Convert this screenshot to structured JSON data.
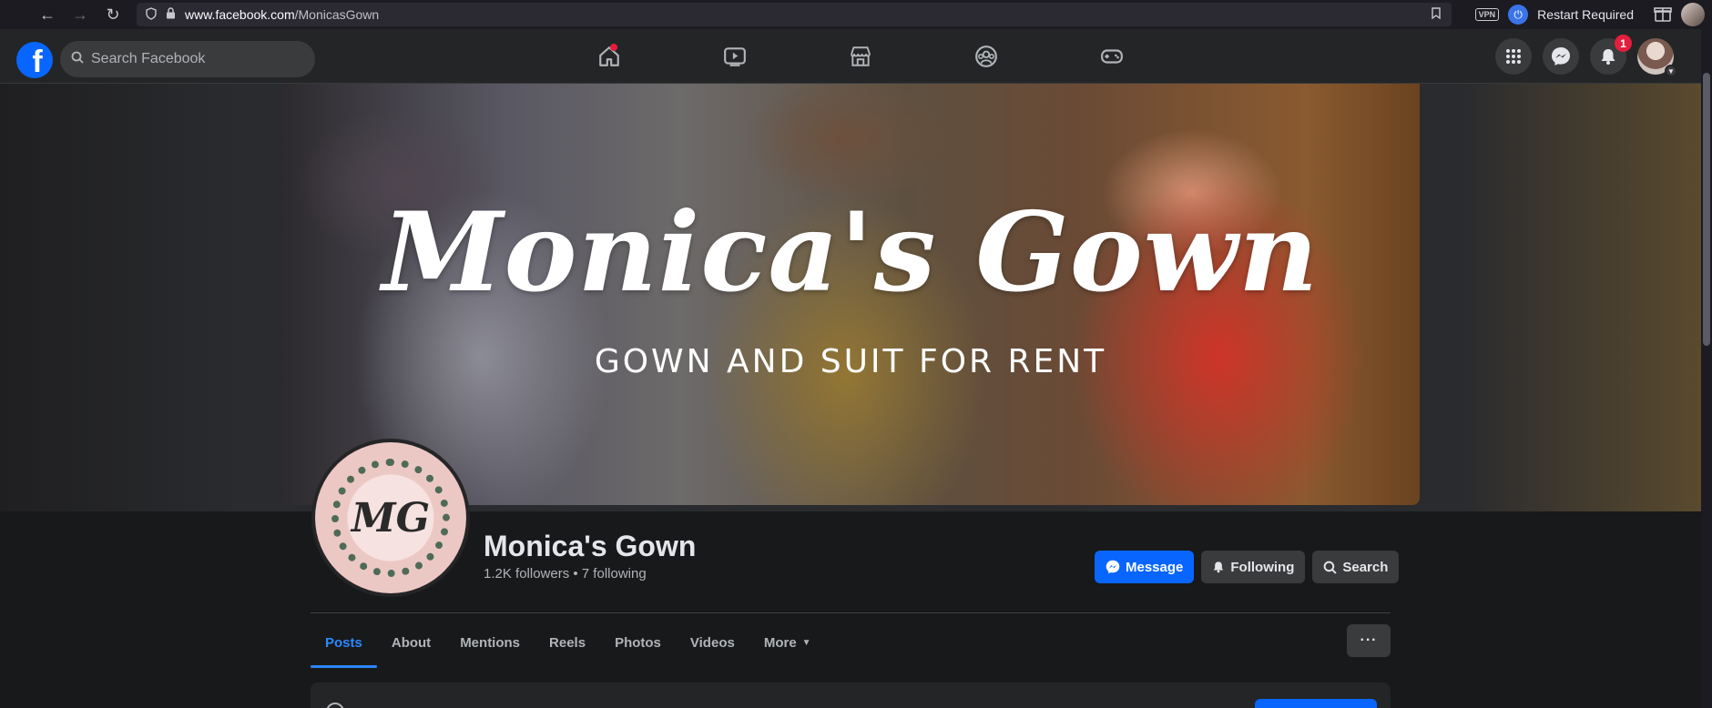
{
  "browser": {
    "url_domain": "www.facebook.com",
    "url_path": "/MonicasGown",
    "vpn_label": "VPN",
    "restart_label": "Restart Required"
  },
  "fb_header": {
    "search_placeholder": "Search Facebook",
    "notifications_count": "1",
    "logo_letter": "f"
  },
  "cover": {
    "title": "Monica's Gown",
    "subtitle": "GOWN AND SUIT FOR RENT"
  },
  "profile": {
    "name": "Monica's Gown",
    "stats": "1.2K followers • 7 following",
    "monogram": "MG",
    "actions": {
      "message": "Message",
      "following": "Following",
      "search": "Search"
    }
  },
  "tabs": [
    {
      "label": "Posts",
      "active": true
    },
    {
      "label": "About"
    },
    {
      "label": "Mentions"
    },
    {
      "label": "Reels"
    },
    {
      "label": "Photos"
    },
    {
      "label": "Videos"
    },
    {
      "label": "More"
    }
  ],
  "more_options_label": "···",
  "colors": {
    "accent": "#0866ff",
    "active_tab": "#2d88ff",
    "notification": "#e41e3f"
  }
}
